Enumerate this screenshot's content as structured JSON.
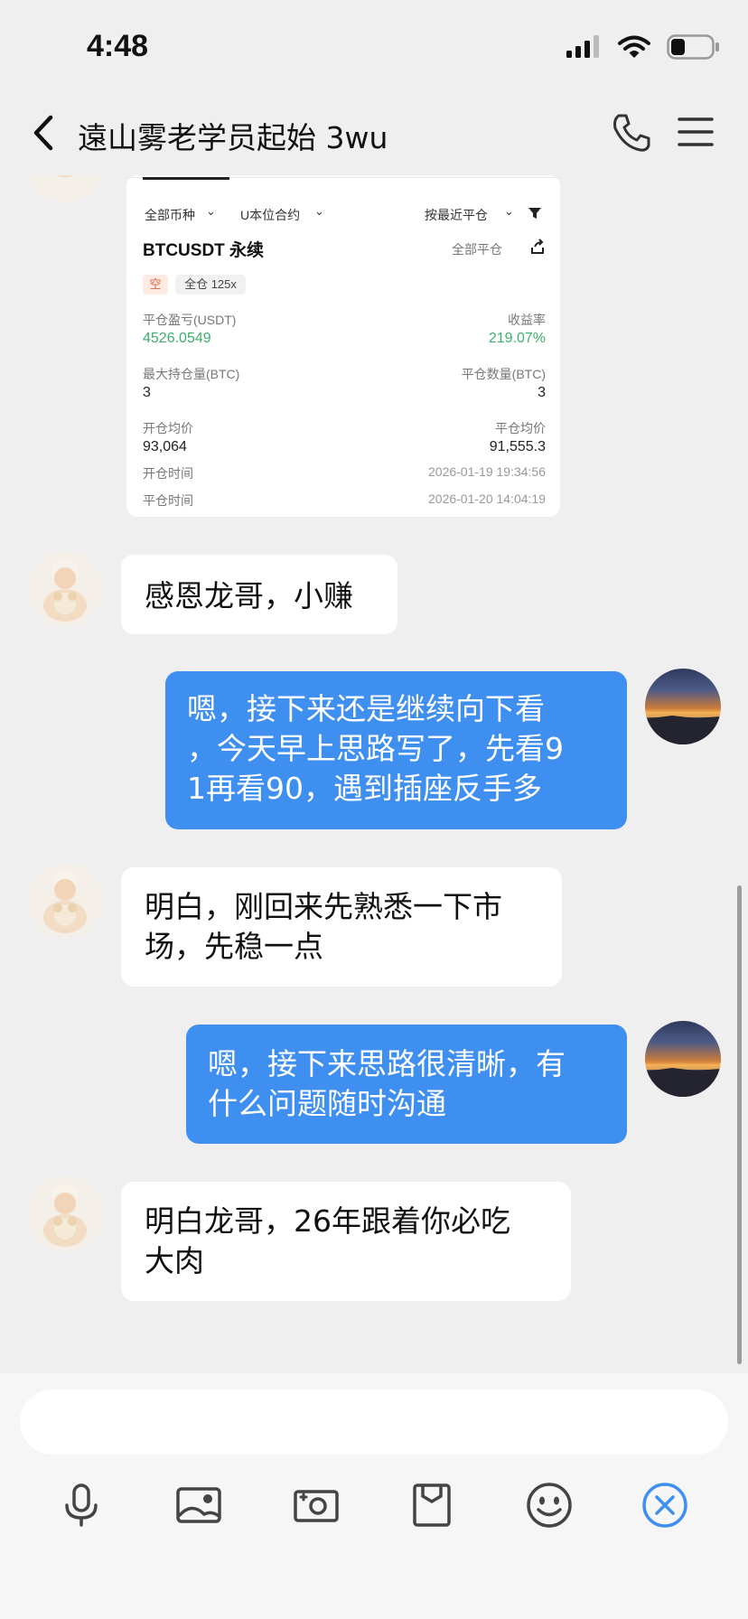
{
  "status_bar": {
    "time": "4:48",
    "battery_level": 0.35
  },
  "header": {
    "title": "遠山雾老学员起始 3wu",
    "icons": [
      "back-chevron-icon",
      "phone-icon",
      "menu-icon"
    ]
  },
  "trade_card": {
    "filter_symbol": "全部币种",
    "filter_contract": "U本位合约",
    "sort": "按最近平仓",
    "pair": "BTCUSDT 永续",
    "close_all": "全部平仓",
    "tag_side": "空",
    "tag_margin": "全仓 125x",
    "pnl_label": "平仓盈亏(USDT)",
    "pnl_value": "4526.0549",
    "roi_label": "收益率",
    "roi_value": "219.07%",
    "max_pos_label": "最大持仓量(BTC)",
    "max_pos_value": "3",
    "close_qty_label": "平仓数量(BTC)",
    "close_qty_value": "3",
    "open_avg_label": "开仓均价",
    "open_avg_value": "93,064",
    "close_avg_label": "平仓均价",
    "close_avg_value": "91,555.3",
    "open_time_label": "开仓时间",
    "open_time_value": "2026-01-19 19:34:56",
    "close_time_label": "平仓时间",
    "close_time_value": "2026-01-20 14:04:19"
  },
  "messages": [
    {
      "side": "in",
      "text": "感恩龙哥，小赚"
    },
    {
      "side": "out",
      "line1": "嗯，接下来还是继续向下看",
      "line2": "，今天早上思路写了，先看9",
      "line3": "1再看90，遇到插座反手多"
    },
    {
      "side": "in",
      "line1": "明白，刚回来先熟悉一下市",
      "line2": "场，先稳一点"
    },
    {
      "side": "out",
      "line1": "嗯，接下来思路很清晰，有",
      "line2": "什么问题随时沟通"
    },
    {
      "side": "in",
      "line1": "明白龙哥，26年跟着你必吃",
      "line2": "大肉"
    }
  ],
  "input": {
    "placeholder": ""
  },
  "toolbar": {
    "tools": [
      "microphone-icon",
      "image-icon",
      "camera-icon",
      "file-icon",
      "emoji-icon",
      "close-circle-icon"
    ],
    "accent": "#3f8ff0"
  },
  "colors": {
    "outgoing_bubble": "#3f8ff0",
    "incoming_bubble": "#ffffff",
    "background": "#efefef",
    "profit_green": "#3cae6d"
  }
}
